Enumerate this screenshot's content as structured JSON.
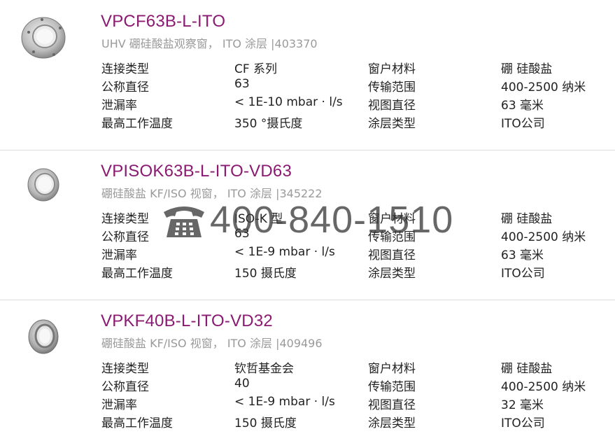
{
  "products": [
    {
      "title": "VPCF63B-L-ITO",
      "subtitle": "UHV 硼硅酸盐观察窗， ITO 涂层 |403370",
      "specs": [
        [
          "连接类型",
          "CF 系列",
          "窗户材料",
          "硼 硅酸盐"
        ],
        [
          "公称直径",
          "63",
          "传输范围",
          "400-2500 纳米"
        ],
        [
          "泄漏率",
          "< 1E-10 mbar · l/s",
          "视图直径",
          "63 毫米"
        ],
        [
          "最高工作温度",
          "350 °摄氏度",
          "涂层类型",
          "ITO公司"
        ]
      ]
    },
    {
      "title": "VPISOK63B-L-ITO-VD63",
      "subtitle": "硼硅酸盐 KF/ISO 视窗， ITO 涂层 |345222",
      "specs": [
        [
          "连接类型",
          "ISO-K 型",
          "窗户材料",
          "硼 硅酸盐"
        ],
        [
          "公称直径",
          "63",
          "传输范围",
          "400-2500 纳米"
        ],
        [
          "泄漏率",
          "< 1E-9 mbar · l/s",
          "视图直径",
          "63 毫米"
        ],
        [
          "最高工作温度",
          "150 摄氏度",
          "涂层类型",
          "ITO公司"
        ]
      ]
    },
    {
      "title": "VPKF40B-L-ITO-VD32",
      "subtitle": "硼硅酸盐 KF/ISO 视窗， ITO 涂层 |409496",
      "specs": [
        [
          "连接类型",
          "钦哲基金会",
          "窗户材料",
          "硼 硅酸盐"
        ],
        [
          "公称直径",
          "40",
          "传输范围",
          "400-2500 纳米"
        ],
        [
          "泄漏率",
          "< 1E-9 mbar · l/s",
          "视图直径",
          "32 毫米"
        ],
        [
          "最高工作温度",
          "150 摄氏度",
          "涂层类型",
          "ITO公司"
        ]
      ]
    }
  ],
  "watermark": {
    "phone": "400-840-1510",
    "icon": "telephone-icon"
  },
  "colors": {
    "title": "#8a1a72",
    "subtitle": "#9a9a9a",
    "divider": "#dcdcdc"
  }
}
